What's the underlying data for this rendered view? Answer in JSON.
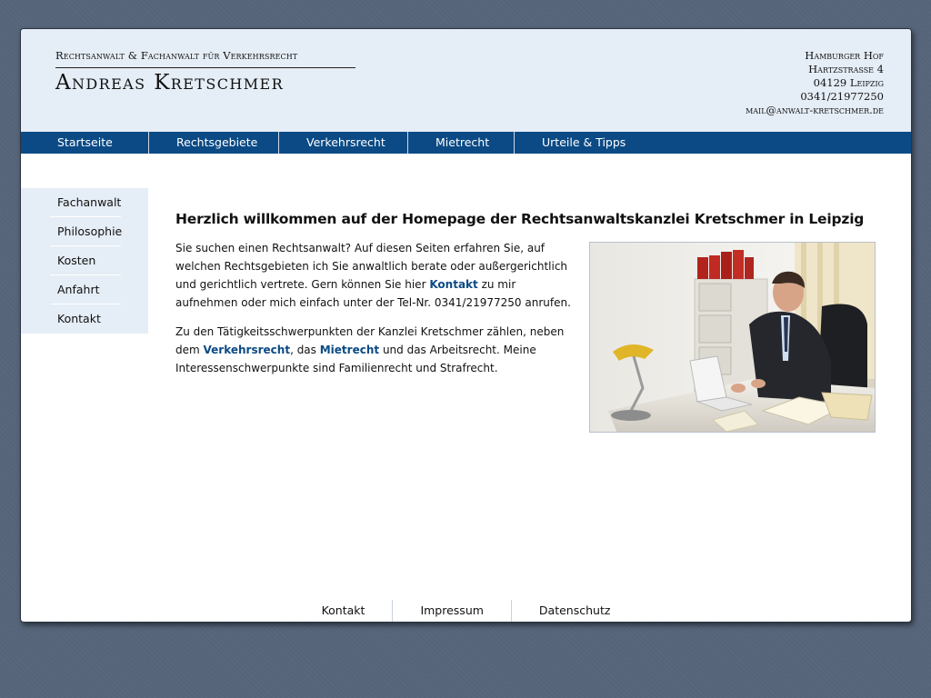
{
  "header": {
    "subtitle": "Rechtsanwalt & Fachanwalt für Verkehrsrecht",
    "name": "Andreas Kretschmer",
    "address": {
      "line1": "Hamburger Hof",
      "line2": "Hartzstrasse 4",
      "line3": "04129 Leipzig",
      "phone": "0341/21977250",
      "email": "mail@anwalt-kretschmer.de"
    }
  },
  "topnav": [
    "Startseite",
    "Rechtsgebiete",
    "Verkehrsrecht",
    "Mietrecht",
    "Urteile & Tipps"
  ],
  "sidenav": [
    "Fachanwalt",
    "Philosophie",
    "Kosten",
    "Anfahrt",
    "Kontakt"
  ],
  "content": {
    "heading": "Herzlich willkommen auf der Homepage der Rechtsanwaltskanzlei Kretschmer in Leipzig",
    "p1_a": "Sie suchen einen Rechtsanwalt? Auf diesen Seiten erfahren Sie, auf welchen Rechtsgebieten ich Sie anwaltlich berate oder außergerichtlich und gerichtlich vertrete. Gern können Sie hier ",
    "p1_link": "Kontakt",
    "p1_b": " zu mir aufnehmen oder mich einfach unter der Tel-Nr. 0341/21977250 anrufen.",
    "p2_a": "Zu den Tätigkeitsschwerpunkten der Kanzlei Kretschmer zählen, neben dem ",
    "p2_link1": "Verkehrsrecht",
    "p2_b": ", das ",
    "p2_link2": "Mietrecht",
    "p2_c": " und das Arbeitsrecht. Meine Interessenschwerpunkte sind Familienrecht und Strafrecht."
  },
  "footer": [
    "Kontakt",
    "Impressum",
    "Datenschutz"
  ],
  "colors": {
    "background": "#556479",
    "header_bg": "#e5edf6",
    "nav_bg": "#0b4a85",
    "link": "#0b4a85"
  }
}
